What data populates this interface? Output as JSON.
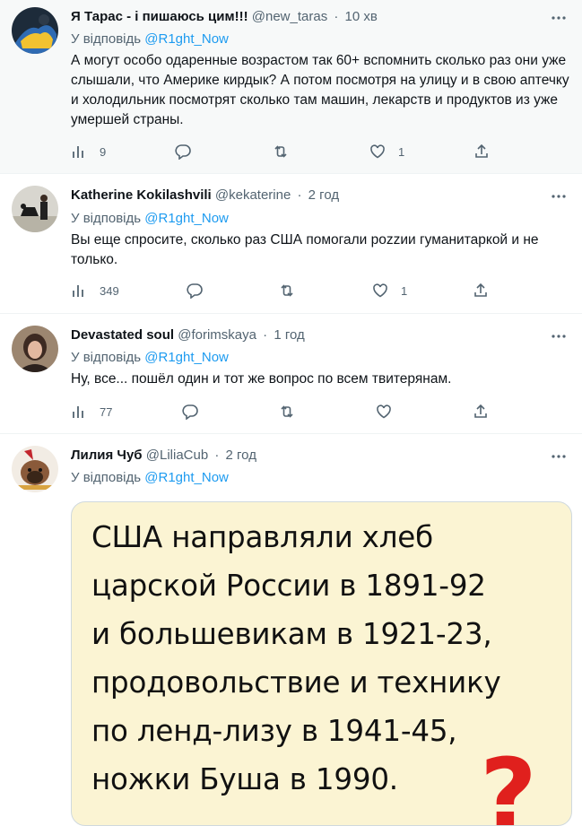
{
  "tweets": [
    {
      "name": "Я Тарас - і пишаюсь цим!!!",
      "handle": "@new_taras",
      "time": "10 хв",
      "reply_prefix": "У відповідь",
      "reply_to": "@R1ght_Now",
      "text": "А могут особо одаренные возрастом так 60+ вспомнить сколько раз они уже слышали, что Америке кирдык? А потом посмотря на улицу и в свою аптечку и холодильник посмотрят сколько там машин, лекарств и продуктов из уже умершей страны.",
      "views": "9",
      "replies": "",
      "retweets": "",
      "likes": "1"
    },
    {
      "name": "Katherine Kokilashvili",
      "handle": "@kekaterine",
      "time": "2 год",
      "reply_prefix": "У відповідь",
      "reply_to": "@R1ght_Now",
      "text": "Вы еще спросите, сколько раз США помогали pоzzии гуманитаркой и не только.",
      "views": "349",
      "replies": "",
      "retweets": "",
      "likes": "1"
    },
    {
      "name": "Devastated soul",
      "handle": "@forimskaya",
      "time": "1 год",
      "reply_prefix": "У відповідь",
      "reply_to": "@R1ght_Now",
      "text": "Ну, все... пошёл один и тот же вопрос по всем твитерянам.",
      "views": "77",
      "replies": "",
      "retweets": "",
      "likes": ""
    },
    {
      "name": "Лилия Чуб",
      "handle": "@LiliaCub",
      "time": "2 год",
      "reply_prefix": "У відповідь",
      "reply_to": "@R1ght_Now",
      "image_text": "США направляли хлеб\nцарской России в 1891-92\nи большевикам в 1921-23,\nпродовольствие и технику\nпо ленд-лизу в 1941-45,\nножки Буша в 1990.",
      "image_mark": "?"
    }
  ],
  "icons": {
    "views": "bar-chart-icon",
    "reply": "reply-bubble-icon",
    "retweet": "retweet-icon",
    "like": "heart-icon",
    "share": "share-icon",
    "more": "more-dots-icon"
  },
  "colors": {
    "link": "#1d9bf0",
    "muted": "#536471",
    "highlight_bg": "#f7f9f9",
    "image_bg": "#fbf4d3",
    "question_mark": "#e0201d"
  }
}
